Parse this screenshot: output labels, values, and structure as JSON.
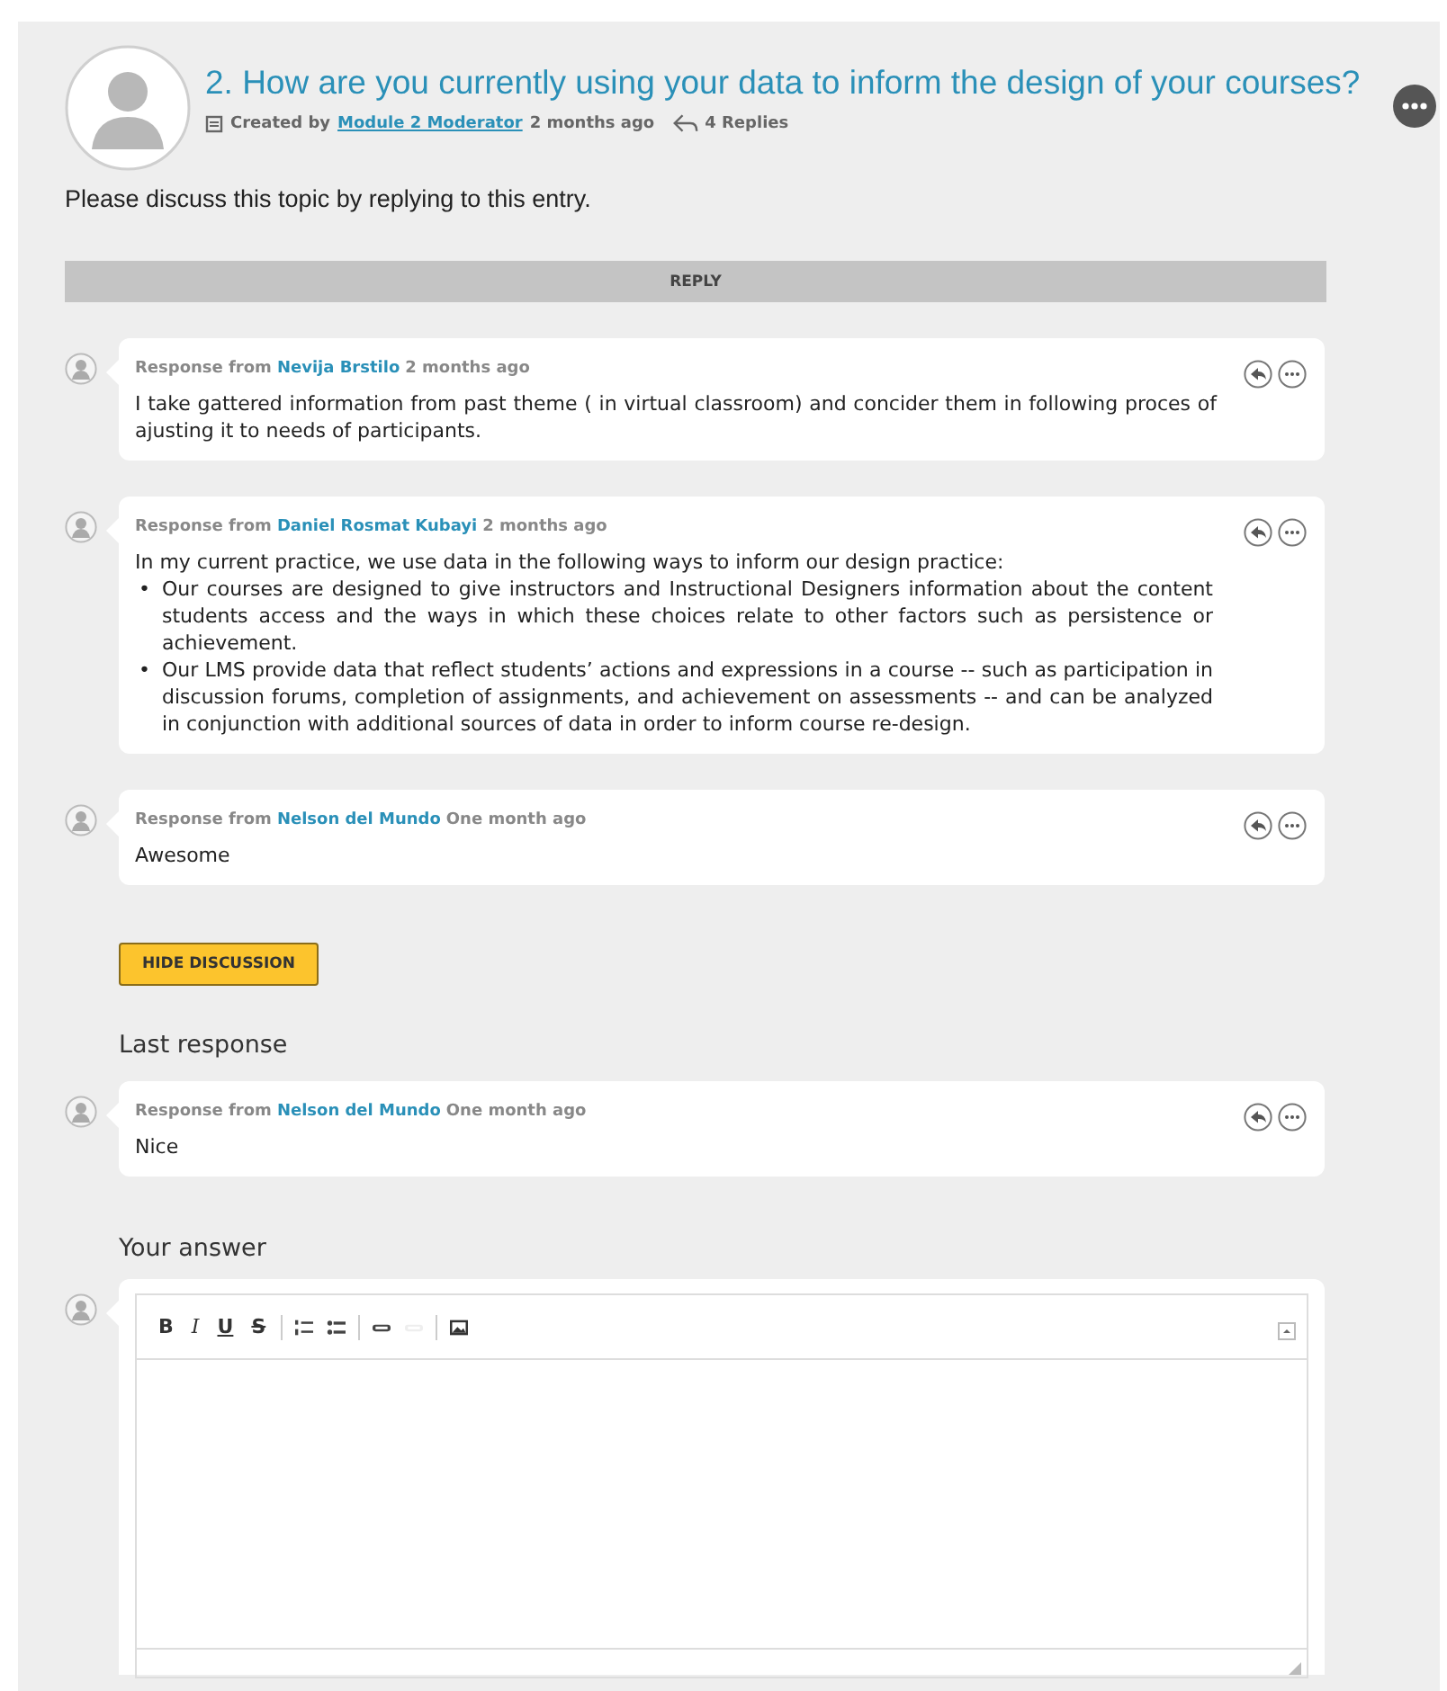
{
  "topic": {
    "title": "2. How are you currently using your data to inform the design of your courses?",
    "created_label": "Created by",
    "author": "Module 2 Moderator",
    "time": "2 months ago",
    "replies": "4 Replies",
    "body": "Please discuss this topic by replying to this entry."
  },
  "reply_button": "REPLY",
  "responses": [
    {
      "prefix": "Response from",
      "author": "Nevija Brstilo",
      "time": "2 months ago",
      "text": "I take gattered information from past theme ( in virtual classroom) and concider them in following proces of ajusting it to needs of participants."
    },
    {
      "prefix": "Response from",
      "author": "Daniel Rosmat Kubayi",
      "time": "2 months ago",
      "text": "In my current practice, we use data in the following ways to inform our design practice:",
      "bullets": [
        {
          "marker": "•",
          "text": "Our courses are designed to give instructors and Instructional Designers information about the content students access and the ways in which these choices relate to other factors such as persistence or achievement."
        },
        {
          "marker": "•",
          "text": "Our LMS provide data that reflect students’ actions and expressions in a course -- such as participation in discussion forums, completion of assignments, and achievement on assessments -- and can be analyzed in conjunction with additional sources of data in order to inform course re-design."
        }
      ]
    },
    {
      "prefix": "Response from",
      "author": "Nelson del Mundo",
      "time": "One month ago",
      "text": "Awesome"
    }
  ],
  "hide_button": "HIDE DISCUSSION",
  "last_heading": "Last response",
  "last_response": {
    "prefix": "Response from",
    "author": "Nelson del Mundo",
    "time": "One month ago",
    "text": "Nice"
  },
  "answer_heading": "Your answer",
  "toolbar": [
    {
      "kind": "bold",
      "label": "B",
      "disabled": false
    },
    {
      "kind": "italic",
      "label": "I",
      "disabled": false
    },
    {
      "kind": "underline",
      "label": "U",
      "disabled": false
    },
    {
      "kind": "strike",
      "label": "S",
      "disabled": false
    },
    {
      "kind": "separator"
    },
    {
      "kind": "numbered-list",
      "disabled": false
    },
    {
      "kind": "bulleted-list",
      "disabled": false
    },
    {
      "kind": "separator"
    },
    {
      "kind": "link",
      "disabled": false
    },
    {
      "kind": "unlink",
      "disabled": true
    },
    {
      "kind": "separator"
    },
    {
      "kind": "image",
      "disabled": false
    }
  ]
}
